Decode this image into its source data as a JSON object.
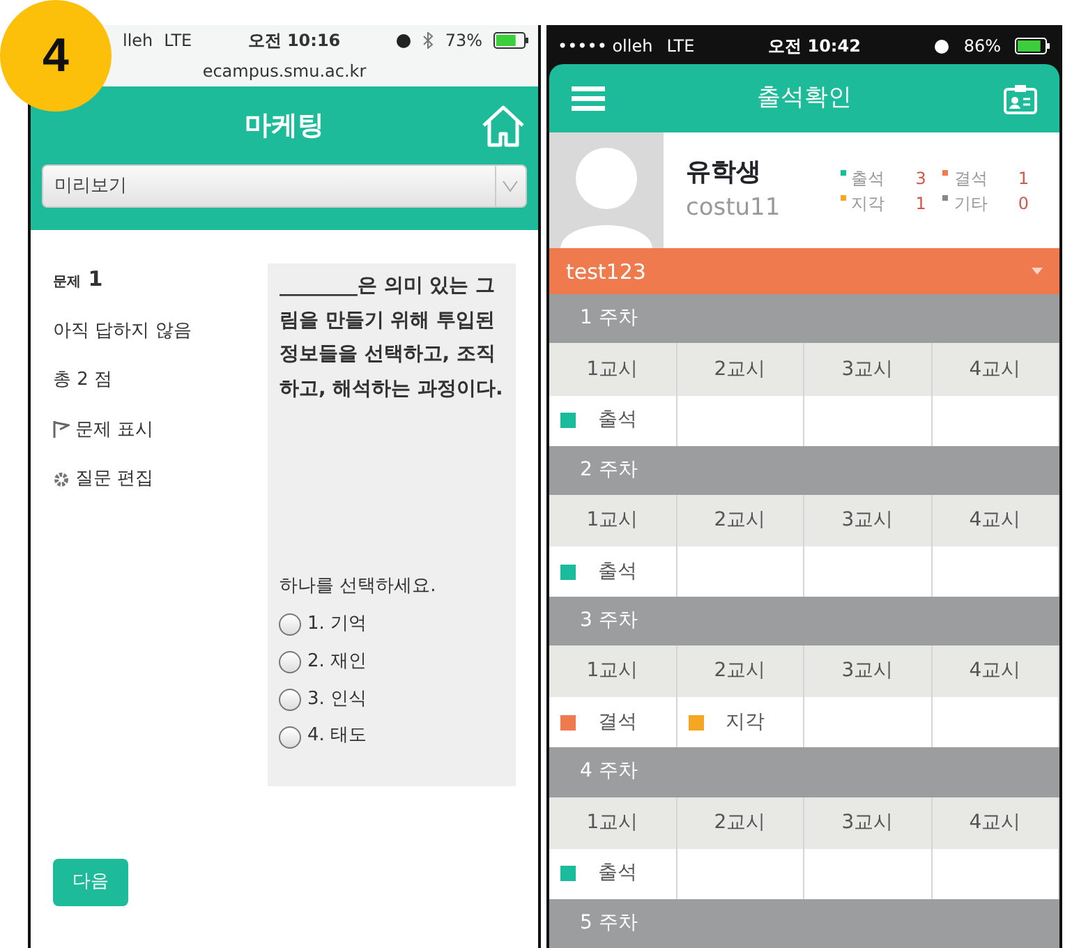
{
  "badge": "4",
  "left_phone": {
    "status_bar": {
      "carrier": "lleh",
      "network": "LTE",
      "time": "오전 10:16",
      "battery": "73%"
    },
    "url": "ecampus.smu.ac.kr",
    "title": "마케팅",
    "dropdown": {
      "value": "미리보기"
    },
    "question_info": {
      "label": "문제",
      "number": "1",
      "state": "아직 답하지 않음",
      "points": "총 2 점",
      "links": [
        {
          "kind": "flag",
          "label": "문제 표시"
        },
        {
          "kind": "gear",
          "label": "질문 편집"
        }
      ]
    },
    "question": {
      "text": "________은 의미 있는 그림을 만들기 위해 투입된 정보들을 선택하고, 조직하고, 해석하는 과정이다.",
      "prompt": "하나를 선택하세요.",
      "options": [
        {
          "label": "1. 기억",
          "selected": false
        },
        {
          "label": "2. 재인",
          "selected": false
        },
        {
          "label": "3. 인식",
          "selected": false
        },
        {
          "label": "4. 태도",
          "selected": false
        }
      ]
    },
    "next_button": "다음"
  },
  "right_phone": {
    "status_bar": {
      "carrier": "••••• olleh",
      "network": "LTE",
      "time": "오전 10:42",
      "battery": "86%"
    },
    "title": "출석확인",
    "profile": {
      "name": "유학생",
      "id": "costu11",
      "stats": [
        {
          "label": "출석",
          "count": "3",
          "color": "#1abc9c"
        },
        {
          "label": "결석",
          "count": "1",
          "color": "#ef7a4e"
        },
        {
          "label": "지각",
          "count": "1",
          "color": "#f5a623"
        },
        {
          "label": "기타",
          "count": "0",
          "color": "#888888"
        }
      ]
    },
    "course": "test123",
    "weeks": [
      {
        "title": "1 주차",
        "periods": [
          "1교시",
          "2교시",
          "3교시",
          "4교시"
        ],
        "records": [
          {
            "label": "출석",
            "color": "#1abc9c"
          }
        ]
      },
      {
        "title": "2 주차",
        "periods": [
          "1교시",
          "2교시",
          "3교시",
          "4교시"
        ],
        "records": [
          {
            "label": "출석",
            "color": "#1abc9c"
          }
        ]
      },
      {
        "title": "3 주차",
        "periods": [
          "1교시",
          "2교시",
          "3교시",
          "4교시"
        ],
        "records": [
          {
            "label": "결석",
            "color": "#ef7a4e"
          },
          {
            "label": "지각",
            "color": "#f5a623"
          }
        ]
      },
      {
        "title": "4 주차",
        "periods": [
          "1교시",
          "2교시",
          "3교시",
          "4교시"
        ],
        "records": [
          {
            "label": "출석",
            "color": "#1abc9c"
          }
        ]
      },
      {
        "title": "5 주차"
      }
    ]
  }
}
